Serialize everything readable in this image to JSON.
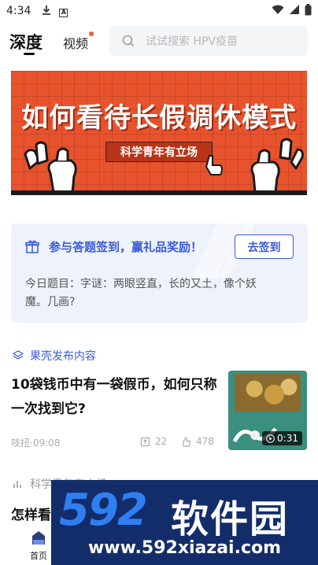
{
  "status_bar": {
    "time": "4:34"
  },
  "header": {
    "tabs": [
      {
        "label": "深度",
        "active": true
      },
      {
        "label": "视频",
        "active": false,
        "has_dot": true
      }
    ],
    "search_placeholder": "试试搜索 HPV疫苗"
  },
  "banner": {
    "title": "如何看待长假调休模式",
    "tag": "科学青年有立场",
    "color": "#e8532d"
  },
  "signin_card": {
    "title": "参与答题签到，赢礼品奖励！",
    "button": "去签到",
    "question": "今日题目：字谜：两眼竖直，长的又土，像个妖魔。几画?"
  },
  "feed": {
    "section_label": "果壳发布内容",
    "article": {
      "title": "10袋钱币中有一袋假币，如何只称一次找到它?",
      "author_time": "吱扭·09:08",
      "shares": "22",
      "likes": "478",
      "video_duration": "0:31"
    },
    "next": {
      "source": "科学青年有立场",
      "title": "怎样看"
    }
  },
  "bottom_nav": {
    "home_label": "首页"
  },
  "watermark": {
    "logo": "592",
    "cn": "软件园",
    "url": "www.592xiazai.com"
  },
  "accent_color": "#3b5bd9"
}
